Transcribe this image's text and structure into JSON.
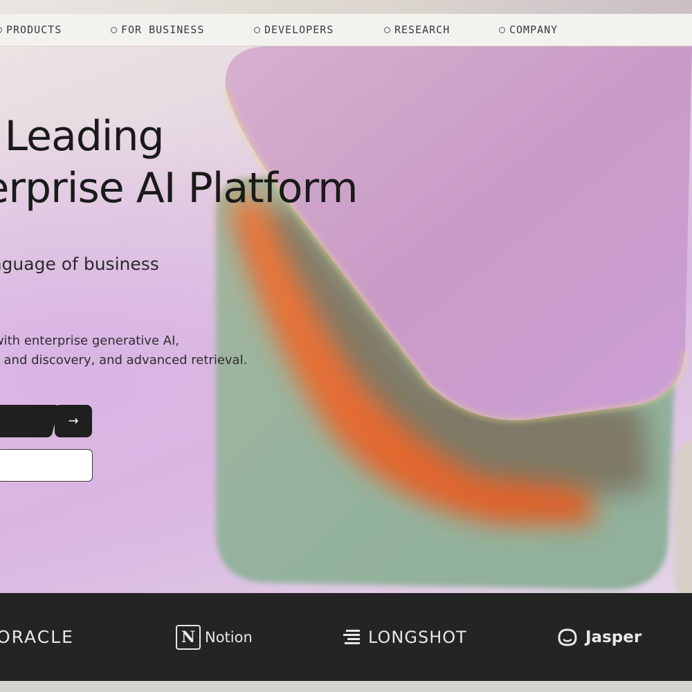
{
  "nav": {
    "items": [
      {
        "label": "PRODUCTS"
      },
      {
        "label": "FOR BUSINESS"
      },
      {
        "label": "DEVELOPERS"
      },
      {
        "label": "RESEARCH"
      },
      {
        "label": "COMPANY"
      }
    ]
  },
  "hero": {
    "headline_line1": "The Leading",
    "headline_line2": "Enterprise AI Platform",
    "subhead": "The language of business",
    "description_line1": "Build with enterprise generative AI,",
    "description_line2": "search and discovery, and advanced retrieval.",
    "arrow_glyph": "→"
  },
  "logos": {
    "oracle": "ORACLE",
    "notion_mark": "N",
    "notion": "Notion",
    "longshot": "LONGSHOT",
    "jasper": "Jasper"
  },
  "colors": {
    "headline": "#1a1a1a",
    "logo_bar": "#242424",
    "accent_orange": "#e6612a",
    "shape_pink": "#c99ac8",
    "shape_green": "#8fb09a"
  }
}
